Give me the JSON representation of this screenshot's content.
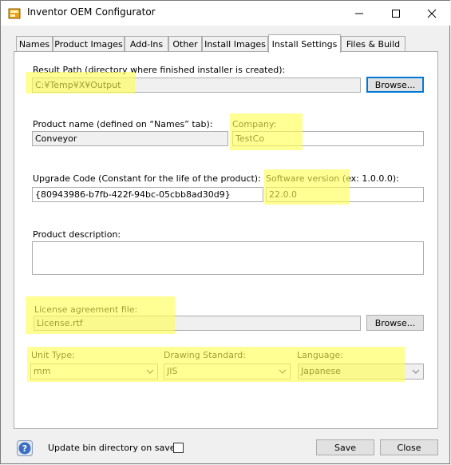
{
  "window": {
    "title": "Inventor OEM Configurator"
  },
  "tabs": [
    {
      "label": "Names"
    },
    {
      "label": "Product Images"
    },
    {
      "label": "Add-Ins"
    },
    {
      "label": "Other"
    },
    {
      "label": "Install Images"
    },
    {
      "label": "Install Settings",
      "active": true
    },
    {
      "label": "Files & Build"
    }
  ],
  "result_path": {
    "label": "Result Path (directory where finished installer is created):",
    "value": "C:¥Temp¥X¥Output",
    "browse_label": "Browse..."
  },
  "product_name": {
    "label": "Product name (defined on “Names” tab):",
    "value": "Conveyor"
  },
  "company": {
    "label": "Company:",
    "value": "TestCo"
  },
  "upgrade_code": {
    "label": "Upgrade Code (Constant for the life of the product):",
    "value": "{80943986-b7fb-422f-94bc-05cbb8ad30d9}"
  },
  "software_version": {
    "label": "Software version (ex: 1.0.0.0):",
    "value": "22.0.0"
  },
  "product_description": {
    "label": "Product description:",
    "value": ""
  },
  "license": {
    "label": "License agreement file:",
    "value": "License.rtf",
    "browse_label": "Browse..."
  },
  "unit_type": {
    "label": "Unit Type:",
    "value": "mm"
  },
  "drawing_standard": {
    "label": "Drawing Standard:",
    "value": "JIS"
  },
  "language": {
    "label": "Language:",
    "value": "Japanese"
  },
  "footer": {
    "update_bin_label": "Update bin directory on save.",
    "save_label": "Save",
    "close_label": "Close"
  },
  "colors": {
    "highlight": "#ffff50",
    "accent": "#0078d7"
  }
}
